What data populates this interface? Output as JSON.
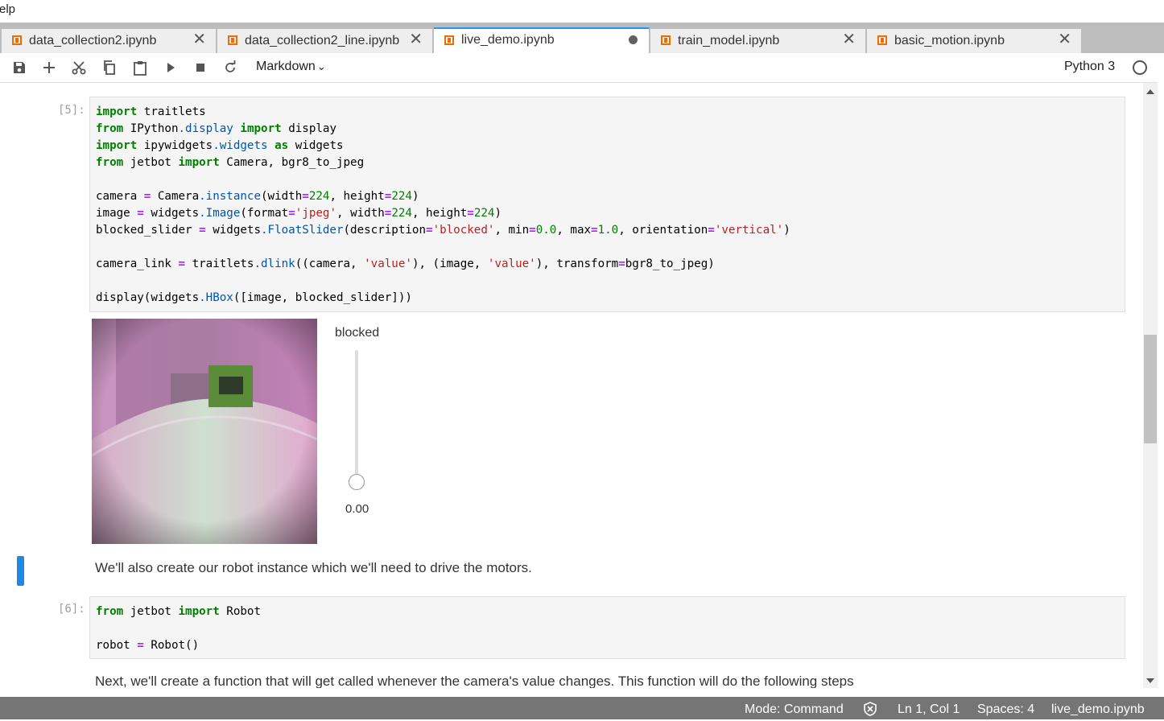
{
  "menu": {
    "stub": "elp"
  },
  "tabs": [
    {
      "label": "data_collection2.ipynb",
      "state": "close"
    },
    {
      "label": "data_collection2_line.ipynb",
      "state": "close"
    },
    {
      "label": "live_demo.ipynb",
      "state": "modified",
      "active": true
    },
    {
      "label": "train_model.ipynb",
      "state": "close"
    },
    {
      "label": "basic_motion.ipynb",
      "state": "close"
    }
  ],
  "toolbar": {
    "buttons": [
      "save-icon",
      "add-icon",
      "cut-icon",
      "copy-icon",
      "paste-icon",
      "run-icon",
      "stop-icon",
      "restart-icon"
    ],
    "cell_type": "Markdown",
    "kernel": "Python 3"
  },
  "cells": {
    "c5": {
      "prompt": "[5]:"
    },
    "widget": {
      "slider_label": "blocked",
      "slider_value": "0.00",
      "slider_fraction": 0.0
    },
    "md1": "We'll also create our robot instance which we'll need to drive the motors.",
    "c6": {
      "prompt": "[6]:"
    },
    "md2": "Next, we'll create a function that will get called whenever the camera's value changes. This function will do the following steps"
  },
  "status": {
    "mode": "Mode: Command",
    "position": "Ln 1, Col 1",
    "spaces": "Spaces: 4",
    "file": "live_demo.ipynb"
  },
  "colors": {
    "accent": "#2196f3",
    "notebook_icon": "#ef6c00",
    "statusbar": "#757575"
  }
}
